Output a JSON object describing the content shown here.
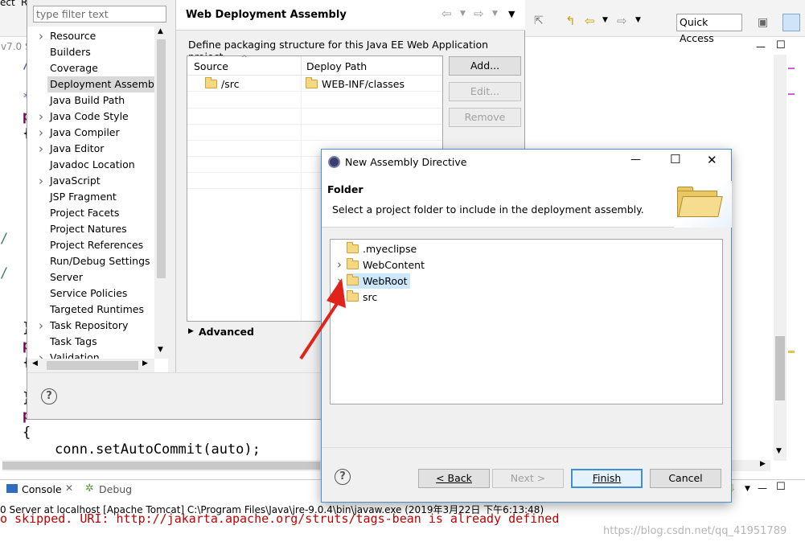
{
  "ide": {
    "menu_fragments": [
      "ect",
      "R"
    ],
    "version_fragment": "v7.0 S",
    "code_lines": [
      "conn.setAutoCommit(auto);"
    ],
    "quick_access": "Quick Access",
    "console_tab": "Console",
    "debug_tab": "Debug",
    "console_status": "0 Server at localhost [Apache Tomcat] C:\\Program Files\\Java\\jre-9.0.4\\bin\\javaw.exe (2019年3月22日 下午6:13:48)",
    "console_error": "o skipped. URI: http://jakarta.apache.org/struts/tags-bean is already defined",
    "watermark": "https://blog.csdn.net/qq_41951789"
  },
  "properties": {
    "filter_placeholder": "type filter text",
    "nav_items": [
      {
        "label": "Resource",
        "expandable": true
      },
      {
        "label": "Builders",
        "expandable": false
      },
      {
        "label": "Coverage",
        "expandable": false
      },
      {
        "label": "Deployment Assembly",
        "expandable": false,
        "selected": true
      },
      {
        "label": "Java Build Path",
        "expandable": false
      },
      {
        "label": "Java Code Style",
        "expandable": true
      },
      {
        "label": "Java Compiler",
        "expandable": true
      },
      {
        "label": "Java Editor",
        "expandable": true
      },
      {
        "label": "Javadoc Location",
        "expandable": false
      },
      {
        "label": "JavaScript",
        "expandable": true
      },
      {
        "label": "JSP Fragment",
        "expandable": false
      },
      {
        "label": "Project Facets",
        "expandable": false
      },
      {
        "label": "Project Natures",
        "expandable": false
      },
      {
        "label": "Project References",
        "expandable": false
      },
      {
        "label": "Run/Debug Settings",
        "expandable": false
      },
      {
        "label": "Server",
        "expandable": false
      },
      {
        "label": "Service Policies",
        "expandable": false
      },
      {
        "label": "Targeted Runtimes",
        "expandable": false
      },
      {
        "label": "Task Repository",
        "expandable": true
      },
      {
        "label": "Task Tags",
        "expandable": false
      },
      {
        "label": "Validation",
        "expandable": true
      }
    ],
    "page_title": "Web Deployment Assembly",
    "description": "Define packaging structure for this Java EE Web Application project.",
    "columns": [
      "Source",
      "Deploy Path"
    ],
    "rows": [
      {
        "source": "/src",
        "deploy": "WEB-INF/classes"
      }
    ],
    "add_button": "Add...",
    "edit_button": "Edit...",
    "remove_button": "Remove",
    "advanced_label": "Advanced"
  },
  "dialog": {
    "title": "New Assembly Directive",
    "heading": "Folder",
    "subheading": "Select a project folder to include in the deployment assembly.",
    "folders": [
      {
        "label": ".myeclipse",
        "expandable": false
      },
      {
        "label": "WebContent",
        "expandable": true
      },
      {
        "label": "WebRoot",
        "expandable": true,
        "selected": true
      },
      {
        "label": "src",
        "expandable": true
      }
    ],
    "back_button": "< Back",
    "next_button": "Next >",
    "finish_button": "Finish",
    "cancel_button": "Cancel"
  },
  "colors": {
    "selection": "#cce8ff",
    "nav_selected": "#d9d9d9",
    "keyword": "#7f0055",
    "error_text": "#c00000",
    "arrow": "#e0241b",
    "dialog_border": "#4a8fd0"
  }
}
